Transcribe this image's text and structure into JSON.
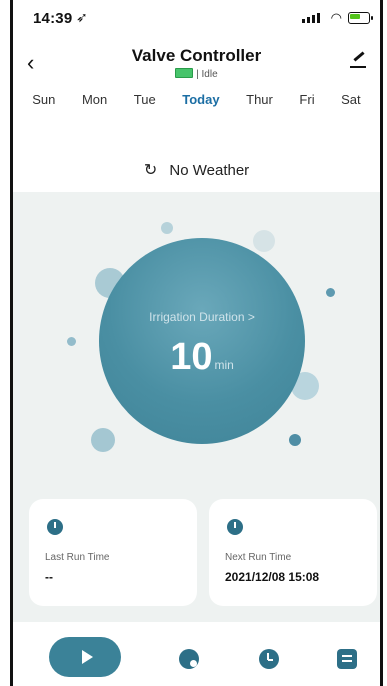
{
  "status_bar": {
    "time": "14:39",
    "location_icon": "location-arrow-icon"
  },
  "header": {
    "title": "Valve Controller",
    "status": "Idle",
    "back_icon": "chevron-left-icon",
    "edit_icon": "edit-icon"
  },
  "days": [
    "Sun",
    "Mon",
    "Tue",
    "Today",
    "Thur",
    "Fri",
    "Sat"
  ],
  "selected_day": "Today",
  "weather": {
    "text": "No Weather",
    "icon": "refresh-icon"
  },
  "irrigation": {
    "label": "Irrigation Duration >",
    "value": "10",
    "unit": "min"
  },
  "cards": {
    "last_run": {
      "label": "Last Run Time",
      "value": "--",
      "icon": "clock-left-icon"
    },
    "next_run": {
      "label": "Next Run Time",
      "value": "2021/12/08 15:08",
      "icon": "clock-right-icon"
    }
  },
  "nav": {
    "play_icon": "play-icon",
    "drop_icon": "water-drop-icon",
    "alarm_icon": "alarm-clock-icon",
    "list_icon": "list-icon"
  },
  "colors": {
    "accent": "#1c6ea4",
    "primary": "#3b8298",
    "circle": "#4a8fa3",
    "background": "#eef2f1"
  }
}
